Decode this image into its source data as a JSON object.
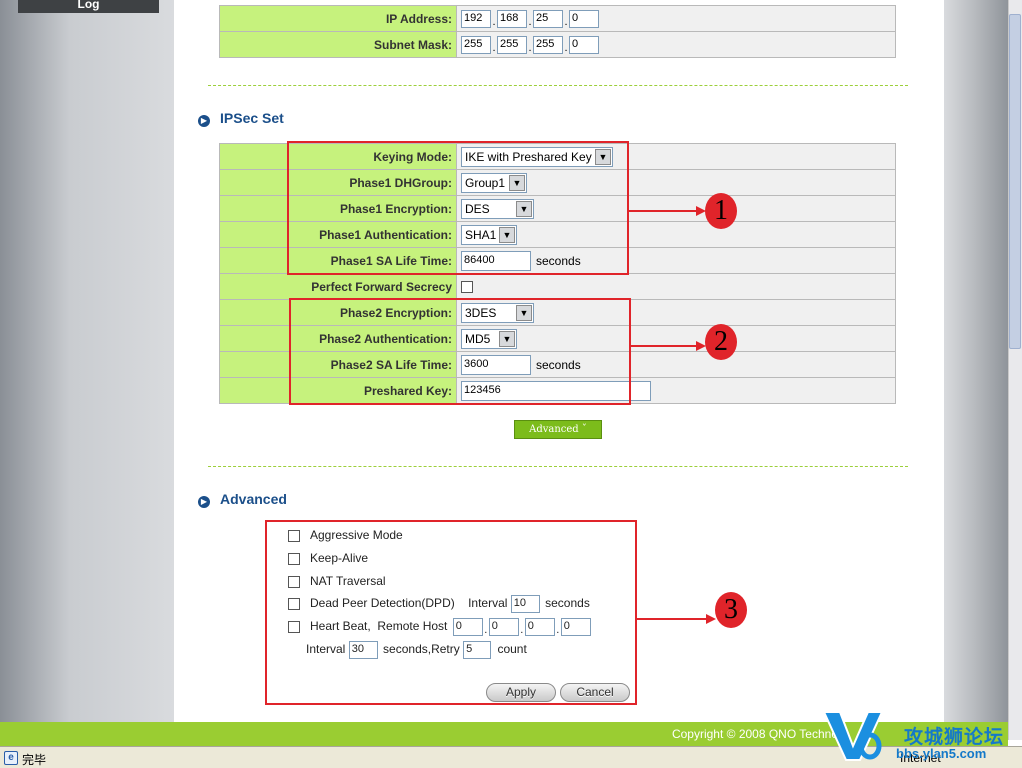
{
  "sidebar": {
    "log_label": "Log"
  },
  "network": {
    "ip_address": {
      "label": "IP Address:",
      "octets": [
        "192",
        "168",
        "25",
        "0"
      ]
    },
    "subnet_mask": {
      "label": "Subnet Mask:",
      "octets": [
        "255",
        "255",
        "255",
        "0"
      ]
    }
  },
  "ipsec": {
    "title": "IPSec Set",
    "keying_mode": {
      "label": "Keying Mode:",
      "value": "IKE with Preshared Key"
    },
    "phase1_dhgroup": {
      "label": "Phase1 DHGroup:",
      "value": "Group1"
    },
    "phase1_encryption": {
      "label": "Phase1 Encryption:",
      "value": "DES"
    },
    "phase1_authentication": {
      "label": "Phase1 Authentication:",
      "value": "SHA1"
    },
    "phase1_sa_life_time": {
      "label": "Phase1 SA Life Time:",
      "value": "86400",
      "unit": "seconds"
    },
    "perfect_forward_secrecy": {
      "label": "Perfect Forward Secrecy",
      "checked": false
    },
    "phase2_encryption": {
      "label": "Phase2 Encryption:",
      "value": "3DES"
    },
    "phase2_authentication": {
      "label": "Phase2 Authentication:",
      "value": "MD5"
    },
    "phase2_sa_life_time": {
      "label": "Phase2 SA Life Time:",
      "value": "3600",
      "unit": "seconds"
    },
    "preshared_key": {
      "label": "Preshared Key:",
      "value": "123456"
    },
    "advanced_button": "Advanced ˇ"
  },
  "advanced": {
    "title": "Advanced",
    "aggressive_mode": {
      "label": "Aggressive Mode",
      "checked": false
    },
    "keep_alive": {
      "label": "Keep-Alive",
      "checked": false
    },
    "nat_traversal": {
      "label": "NAT Traversal",
      "checked": false
    },
    "dpd": {
      "label": "Dead Peer Detection(DPD)",
      "checked": false,
      "interval_label": "Interval",
      "interval": "10",
      "unit": "seconds"
    },
    "heartbeat": {
      "label": "Heart Beat,  Remote Host",
      "checked": false,
      "remote_host": [
        "0",
        "0",
        "0",
        "0"
      ],
      "interval_label": "Interval",
      "interval": "30",
      "retry_label": "seconds,Retry",
      "retry": "5",
      "count_label": "count"
    },
    "apply_button": "Apply",
    "cancel_button": "Cancel"
  },
  "callouts": [
    "1",
    "2",
    "3"
  ],
  "footer": {
    "copyright": "Copyright © 2008 QNO Techno"
  },
  "statusbar": {
    "status": "完毕",
    "zone": "Internet"
  },
  "watermark": {
    "title": "攻城狮论坛",
    "url": "bbs.ylan5.com"
  },
  "colors": {
    "label_green": "#c6f27d",
    "accent_red": "#e0242a",
    "section_blue": "#1b4f8a",
    "footer_green": "#9acd32"
  }
}
